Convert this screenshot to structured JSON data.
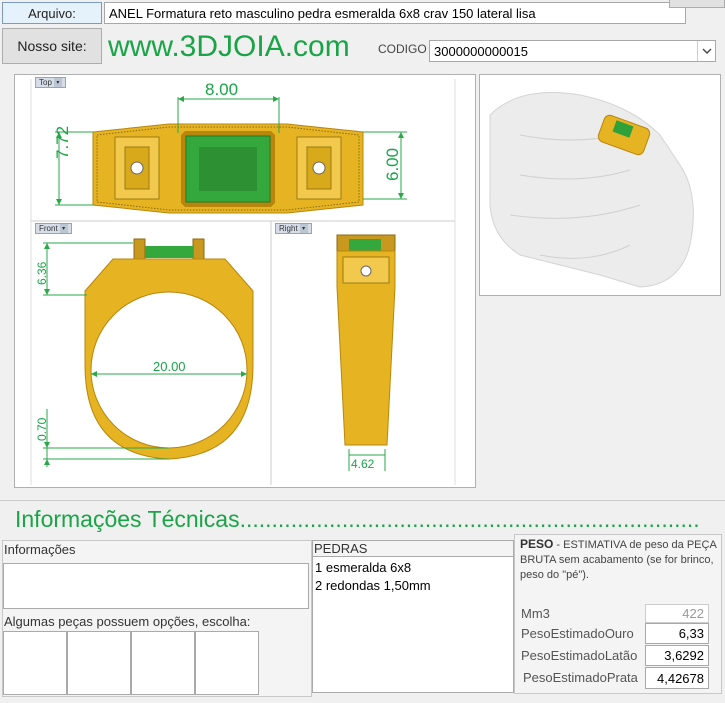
{
  "header": {
    "arquivo_label": "Arquivo:",
    "arquivo_value": "ANEL Formatura reto masculino pedra esmeralda 6x8 crav 150 lateral lisa",
    "site_button": "Nosso site:",
    "site_url": "www.3DJOIA.com",
    "codigo_label": "CODIGO",
    "codigo_value": "3000000000015"
  },
  "views": {
    "top_label": "Top",
    "front_label": "Front",
    "right_label": "Right",
    "dims": {
      "top_width": "8.00",
      "top_height_left": "7.72",
      "top_height_right": "6.00",
      "front_height": "6.36",
      "front_diameter": "20.00",
      "front_bottom": "0.70",
      "right_width": "4.62"
    }
  },
  "info": {
    "title": "Informações Técnicas",
    "dots": "........................................................................",
    "informacoes_label": "Informações",
    "opcoes_label": "Algumas peças possuem opções, escolha:",
    "pedras_label": "PEDRAS",
    "pedras": [
      "1 esmeralda 6x8",
      "2 redondas 1,50mm"
    ],
    "peso_title": "PESO",
    "peso_desc": " -  ESTIMATIVA de peso da PEÇA BRUTA sem acabamento (se for brinco, peso do \"pé\").",
    "rows": [
      {
        "label": "Mm3",
        "value": "422"
      },
      {
        "label": "PesoEstimadoOuro",
        "value": "6,33"
      },
      {
        "label": "PesoEstimadoLatão",
        "value": "3,6292"
      },
      {
        "label": "PesoEstimadoPrata",
        "value": "4,42678"
      }
    ]
  },
  "colors": {
    "accent": "#1aa448",
    "gold": "#e6b422",
    "emerald": "#2fa13a"
  }
}
